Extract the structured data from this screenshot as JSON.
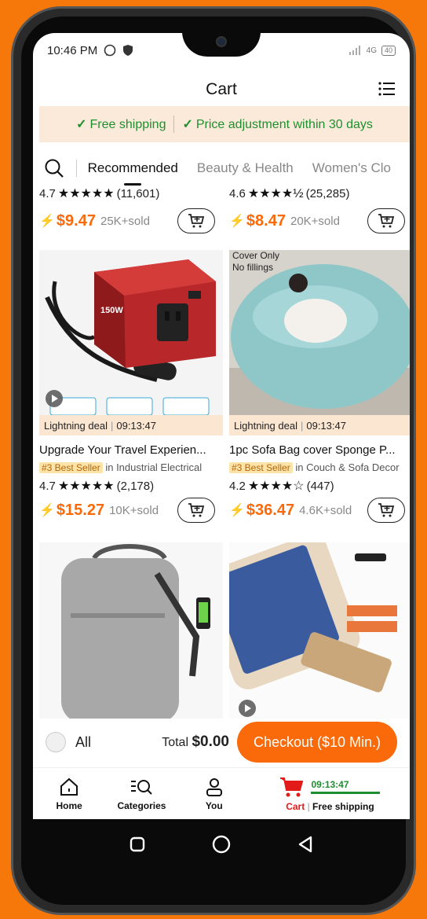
{
  "status": {
    "time": "10:46 PM",
    "network": "4G",
    "battery": "40"
  },
  "header": {
    "title": "Cart"
  },
  "banner": {
    "free_shipping": "Free shipping",
    "price_adjust": "Price adjustment within 30 days"
  },
  "tabs": [
    "Recommended",
    "Beauty & Health",
    "Women's Clo"
  ],
  "top_row": [
    {
      "rating": "4.7",
      "stars": "★★★★★",
      "reviews": "(11,601)",
      "price": "$9.47",
      "sold": "25K+sold"
    },
    {
      "rating": "4.6",
      "stars": "★★★★½",
      "reviews": "(25,285)",
      "price": "$8.47",
      "sold": "20K+sold"
    }
  ],
  "products": [
    {
      "deal_label": "Lightning deal",
      "deal_time": "09:13:47",
      "title": "Upgrade Your Travel Experien...",
      "badge": "#3 Best Seller",
      "category": "in Industrial Electrical",
      "rating": "4.7",
      "stars": "★★★★★",
      "reviews": "(2,178)",
      "price": "$15.27",
      "sold": "10K+sold",
      "img_text": "150W"
    },
    {
      "deal_label": "Lightning deal",
      "deal_time": "09:13:47",
      "title": "1pc Sofa Bag cover Sponge P...",
      "badge": "#3 Best Seller",
      "category": "in Couch & Sofa Decor",
      "rating": "4.2",
      "stars": "★★★★☆",
      "reviews": "(447)",
      "price": "$36.47",
      "sold": "4.6K+sold",
      "img_text1": "Cover Only",
      "img_text2": "No fillings"
    }
  ],
  "bottom": {
    "all_label": "All",
    "total_label": "Total",
    "total_value": "$0.00",
    "checkout_label": "Checkout ($10 Min.)"
  },
  "nav": {
    "home": "Home",
    "categories": "Categories",
    "you": "You",
    "cart": "Cart",
    "free_shipping": "Free shipping",
    "timer": "09:13:47"
  },
  "colors": {
    "accent": "#FA6A0A",
    "green": "#1e8f2e",
    "background": "#F7780A"
  }
}
